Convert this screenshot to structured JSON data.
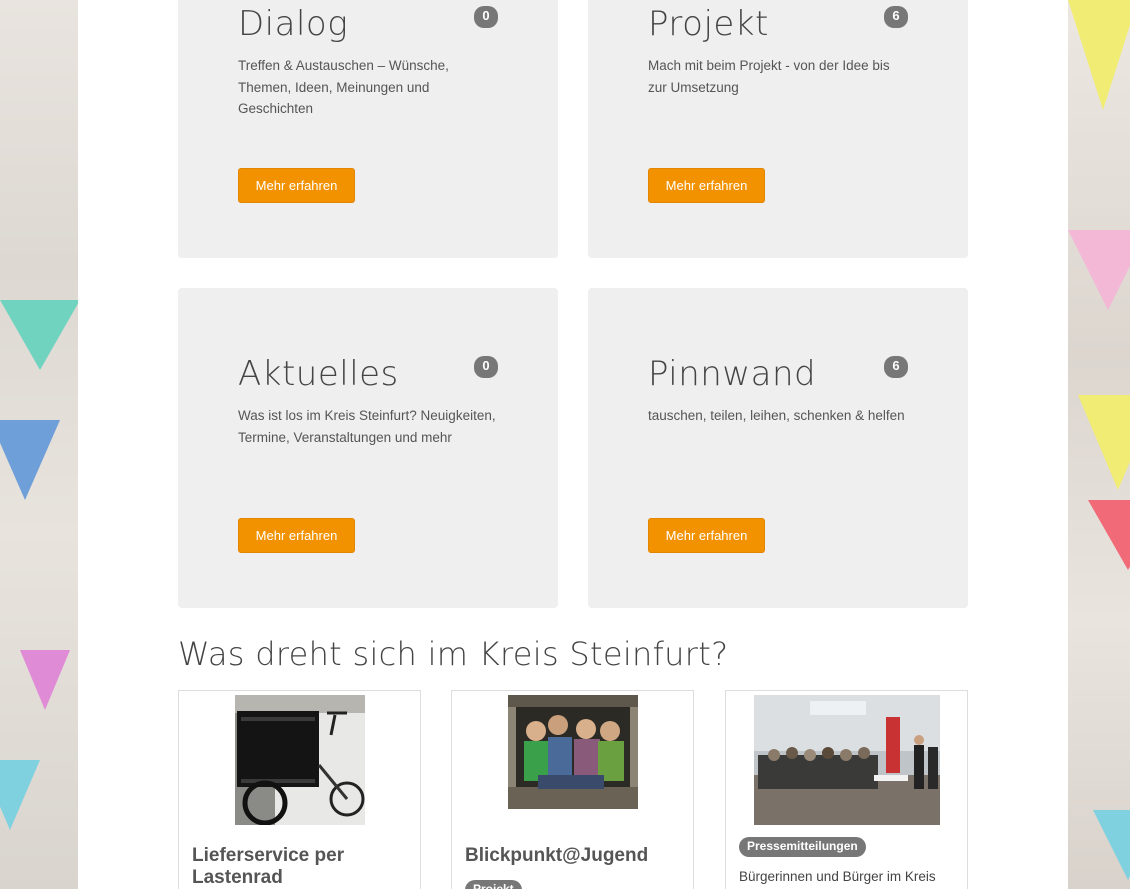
{
  "cards": [
    {
      "title": "Dialog",
      "count": "0",
      "text": "Treffen & Austauschen – Wünsche, Themen, Ideen, Meinungen und Geschichten",
      "button": "Mehr erfahren"
    },
    {
      "title": "Projekt",
      "count": "6",
      "text": "Mach mit beim Projekt - von der Idee bis zur Umsetzung",
      "button": "Mehr erfahren"
    },
    {
      "title": "Aktuelles",
      "count": "0",
      "text": "Was ist los im Kreis Steinfurt? Neuigkeiten, Termine, Veranstaltungen und mehr",
      "button": "Mehr erfahren"
    },
    {
      "title": "Pinnwand",
      "count": "6",
      "text": "tauschen, teilen, leihen, schenken & helfen",
      "button": "Mehr erfahren"
    }
  ],
  "section": {
    "title": "Was dreht sich im Kreis Steinfurt?"
  },
  "news": [
    {
      "title": "Lieferservice per Lastenrad",
      "tag": "",
      "excerpt": ""
    },
    {
      "title": "Blickpunkt@Jugend",
      "tag": "Projekt",
      "excerpt": ""
    },
    {
      "title": "",
      "tag": "Pressemitteilungen",
      "excerpt": "Bürgerinnen und Bürger im Kreis"
    }
  ],
  "colors": {
    "accent": "#f39200",
    "card_bg": "#efefef",
    "badge": "#777777"
  }
}
